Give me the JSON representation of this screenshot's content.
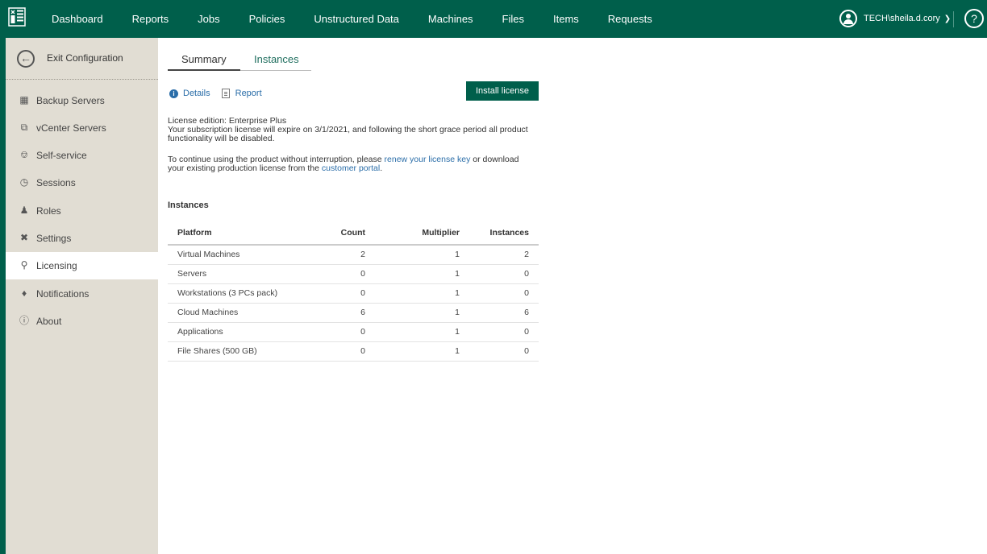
{
  "topbar": {
    "nav": [
      "Dashboard",
      "Reports",
      "Jobs",
      "Policies",
      "Unstructured Data",
      "Machines",
      "Files",
      "Items",
      "Requests"
    ],
    "user": "TECH\\sheila.d.cory",
    "help": "?"
  },
  "sidebar": {
    "exit": "Exit Configuration",
    "items": [
      {
        "label": "Backup Servers",
        "icon": "backup-server-icon"
      },
      {
        "label": "vCenter Servers",
        "icon": "vcenter-icon"
      },
      {
        "label": "Self-service",
        "icon": "cart-icon"
      },
      {
        "label": "Sessions",
        "icon": "clock-icon"
      },
      {
        "label": "Roles",
        "icon": "user-icon"
      },
      {
        "label": "Settings",
        "icon": "tools-icon"
      },
      {
        "label": "Licensing",
        "icon": "license-icon"
      },
      {
        "label": "Notifications",
        "icon": "bell-icon"
      },
      {
        "label": "About",
        "icon": "info-icon"
      }
    ]
  },
  "tabs": {
    "summary": "Summary",
    "instances": "Instances"
  },
  "actions": {
    "details": "Details",
    "report": "Report",
    "install": "Install license"
  },
  "license": {
    "edition": "License edition: Enterprise Plus",
    "expire_line1": "Your subscription license will expire on 3/1/2021, and following the short grace period all product",
    "expire_line2": "functionality will be disabled.",
    "cont_prefix": "To continue using the product without interruption, please ",
    "renew_link": "renew your license key",
    "cont_middle": " or download",
    "cont_line2_prefix": "your existing production license from the ",
    "portal_link": "customer portal",
    "cont_suffix": "."
  },
  "instances": {
    "title": "Instances",
    "headers": [
      "Platform",
      "Count",
      "Multiplier",
      "Instances"
    ],
    "rows": [
      [
        "Virtual Machines",
        "2",
        "1",
        "2"
      ],
      [
        "Servers",
        "0",
        "1",
        "0"
      ],
      [
        "Workstations (3 PCs pack)",
        "0",
        "1",
        "0"
      ],
      [
        "Cloud Machines",
        "6",
        "1",
        "6"
      ],
      [
        "Applications",
        "0",
        "1",
        "0"
      ],
      [
        "File Shares (500 GB)",
        "0",
        "1",
        "0"
      ]
    ]
  }
}
